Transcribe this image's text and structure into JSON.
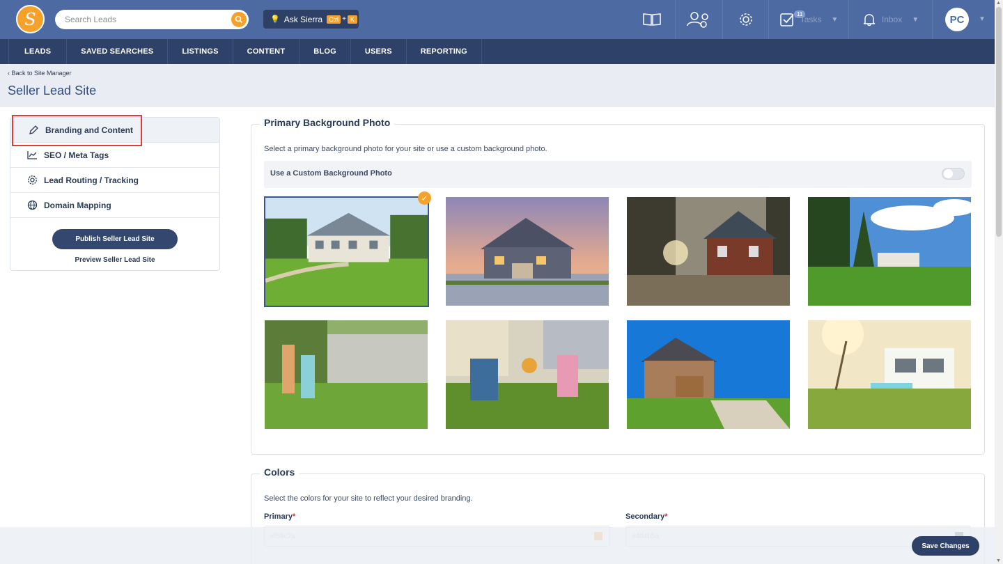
{
  "topbar": {
    "search_placeholder": "Search Leads",
    "ask_label": "Ask Sierra",
    "ask_key1": "Ctrl",
    "ask_plus": "+",
    "ask_key2": "K",
    "tasks_label": "Tasks",
    "tasks_badge": "11",
    "inbox_label": "Inbox",
    "avatar_initials": "PC"
  },
  "nav": {
    "items": [
      "LEADS",
      "SAVED SEARCHES",
      "LISTINGS",
      "CONTENT",
      "BLOG",
      "USERS",
      "REPORTING"
    ]
  },
  "header": {
    "back_link": "‹ Back to Site Manager",
    "title": "Seller Lead Site"
  },
  "sidebar": {
    "items": [
      {
        "label": "Branding and Content",
        "icon": "pencil-icon"
      },
      {
        "label": "SEO / Meta Tags",
        "icon": "chart-line-icon"
      },
      {
        "label": "Lead Routing / Tracking",
        "icon": "gear-icon"
      },
      {
        "label": "Domain Mapping",
        "icon": "globe-icon"
      }
    ],
    "publish_label": "Publish Seller Lead Site",
    "preview_label": "Preview Seller Lead Site"
  },
  "background": {
    "title": "Primary Background Photo",
    "description": "Select a primary background photo for your site or use a custom background photo.",
    "custom_toggle_label": "Use a Custom Background Photo",
    "custom_toggle_on": false,
    "selected_index": 0
  },
  "colors": {
    "title": "Colors",
    "description": "Select the colors for your site to reflect your desired branding.",
    "primary_label": "Primary",
    "primary_value": "#f59c2a",
    "secondary_label": "Secondary",
    "secondary_value": "#404b5a",
    "required_mark": "*"
  },
  "footer": {
    "save_label": "Save Changes"
  },
  "theme": {
    "topbar": "#4d6aa3",
    "nav": "#2e4168",
    "accent": "#f6a12a"
  }
}
